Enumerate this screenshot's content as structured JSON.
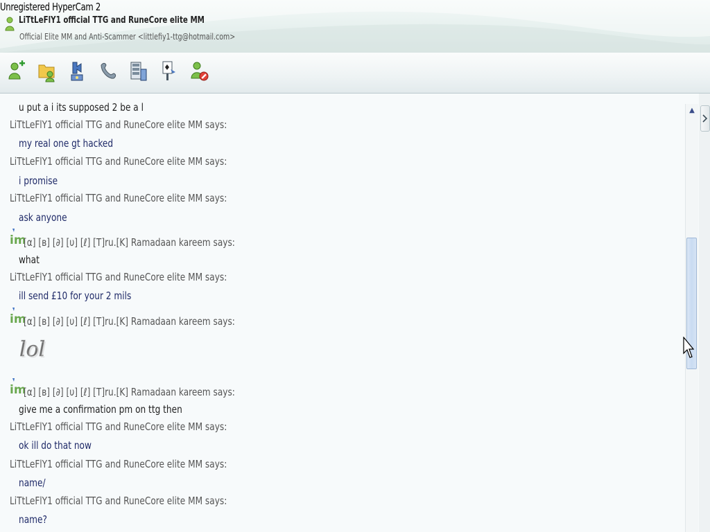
{
  "watermark": "Unregistered HyperCam 2",
  "contact": {
    "name": "LiTtLeFlY1 official TTG and RuneCore elite MM",
    "status": "Official Elite MM and Anti-Scammer <littlefiy1-ttg@hotmail.com>"
  },
  "toolbar": {
    "buttons": [
      {
        "icon": "invite-contact-icon"
      },
      {
        "icon": "send-files-icon"
      },
      {
        "icon": "video-call-icon"
      },
      {
        "icon": "call-contact-icon"
      },
      {
        "icon": "activities-icon"
      },
      {
        "icon": "games-icon"
      },
      {
        "icon": "block-contact-icon"
      }
    ]
  },
  "chat": {
    "partial_top": "u put a i its supposed 2 be a l",
    "messages": [
      {
        "sender": "LiTtLeFlY1 official TTG and RuneCore elite MM says:",
        "text": "my real one gt hacked",
        "im": false
      },
      {
        "sender": "LiTtLeFlY1 official TTG and RuneCore elite MM says:",
        "text": "i promise",
        "im": false
      },
      {
        "sender": "LiTtLeFlY1 official TTG and RuneCore elite MM says:",
        "text": "ask anyone",
        "im": false
      },
      {
        "sender": "[α] [в] [∂] [υ] [ℓ] [T]ru.[K] Ramadaan kareem says:",
        "text": "what",
        "im": true
      },
      {
        "sender": "LiTtLeFlY1 official TTG and RuneCore elite MM says:",
        "text": "ill send £10 for your 2 mils",
        "im": false
      },
      {
        "sender": "[α] [в] [∂] [υ] [ℓ] [T]ru.[K] Ramadaan kareem says:",
        "text": "",
        "emoticon": "lol",
        "im": true
      },
      {
        "sender": "[α] [в] [∂] [υ] [ℓ] [T]ru.[K] Ramadaan kareem says:",
        "text": "give me a confirmation pm on ttg then",
        "im": true
      },
      {
        "sender": "LiTtLeFlY1 official TTG and RuneCore elite MM says:",
        "text": "ok ill do that now",
        "im": false
      },
      {
        "sender": "LiTtLeFlY1 official TTG and RuneCore elite MM says:",
        "text": "name/",
        "im": false
      },
      {
        "sender": "LiTtLeFlY1 official TTG and RuneCore elite MM says:",
        "text": "name?",
        "im": false
      }
    ],
    "lol_text": "lol"
  },
  "colors": {
    "accent_green": "#6aa84f",
    "message_blue": "#1f2a68"
  }
}
